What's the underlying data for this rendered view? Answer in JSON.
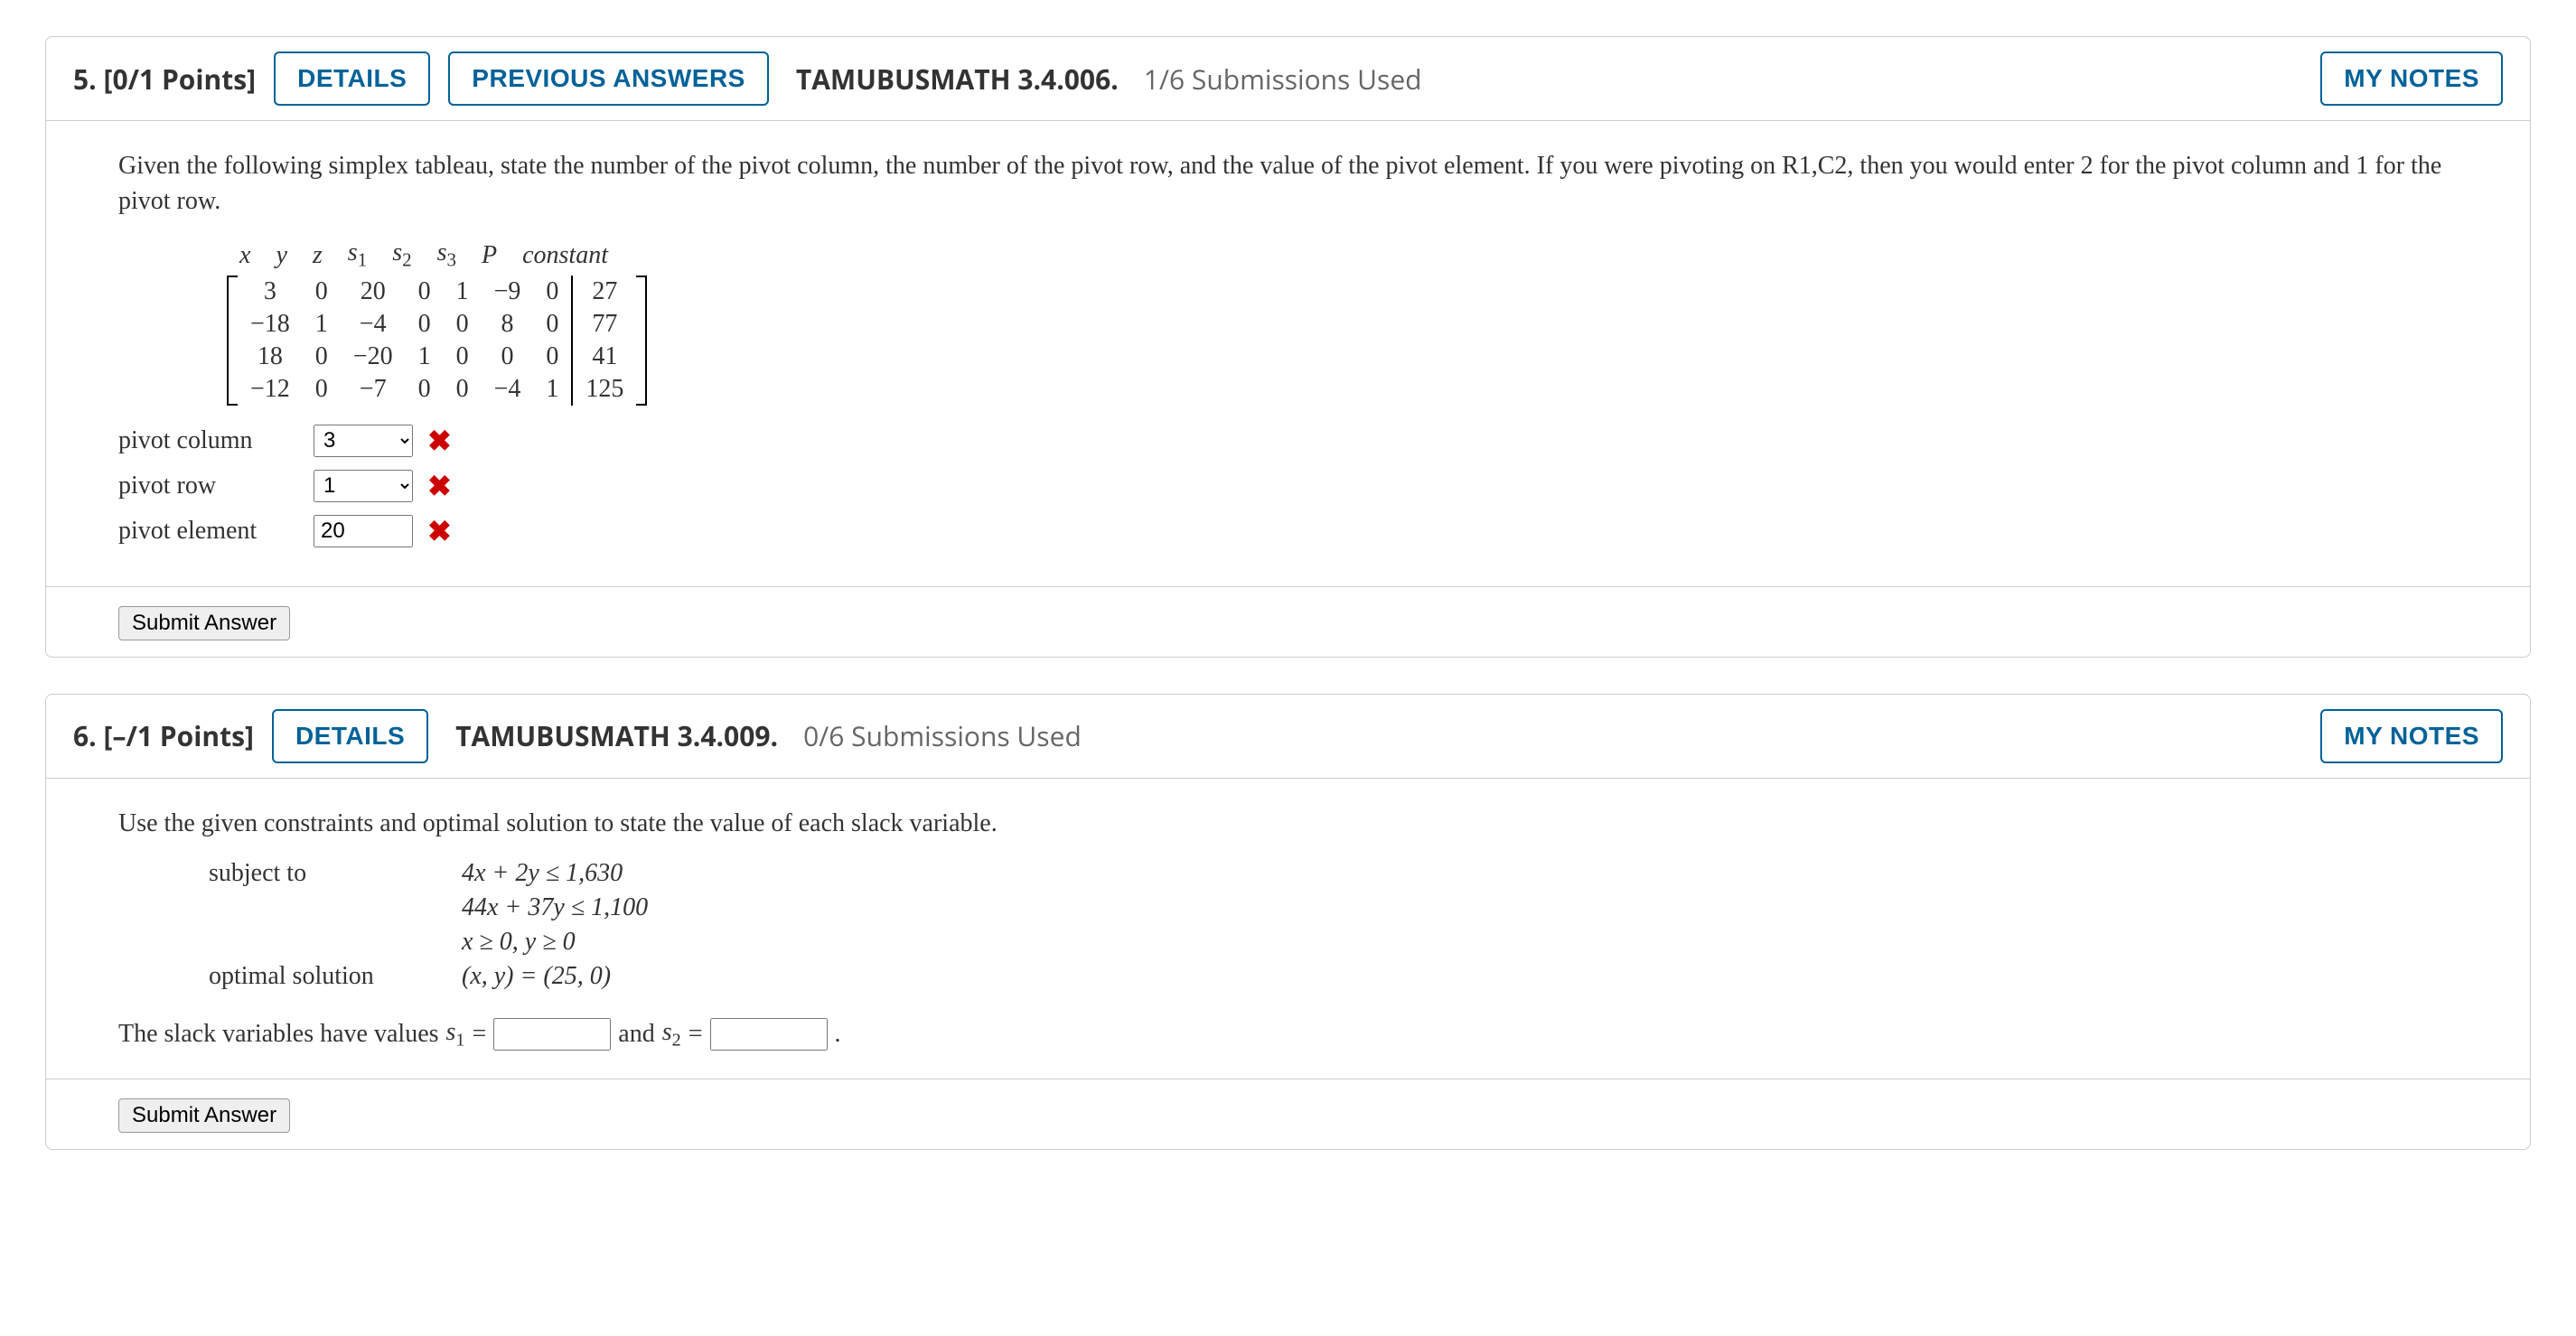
{
  "q5": {
    "number": "5.",
    "points": "[0/1 Points]",
    "details": "DETAILS",
    "prev": "PREVIOUS ANSWERS",
    "probId": "TAMUBUSMATH 3.4.006.",
    "subUsed": "1/6 Submissions Used",
    "myNotes": "MY NOTES",
    "instr": "Given the following simplex tableau, state the number of the pivot column, the number of the pivot row, and the value of the pivot element. If you were pivoting on R1,C2, then you would enter 2 for the pivot column and 1 for the pivot row.",
    "headers": {
      "x": "x",
      "y": "y",
      "z": "z",
      "s1a": "s",
      "s1b": "1",
      "s2a": "s",
      "s2b": "2",
      "s3a": "s",
      "s3b": "3",
      "P": "P",
      "const": "constant"
    },
    "rows": [
      [
        "3",
        "0",
        "20",
        "0",
        "1",
        "−9",
        "0",
        "27"
      ],
      [
        "−18",
        "1",
        "−4",
        "0",
        "0",
        "8",
        "0",
        "77"
      ],
      [
        "18",
        "0",
        "−20",
        "1",
        "0",
        "0",
        "0",
        "41"
      ],
      [
        "−12",
        "0",
        "−7",
        "0",
        "0",
        "−4",
        "1",
        "125"
      ]
    ],
    "answers": {
      "pcLabel": "pivot column",
      "pcVal": "3",
      "prLabel": "pivot row",
      "prVal": "1",
      "peLabel": "pivot element",
      "peVal": "20"
    },
    "submit": "Submit Answer"
  },
  "q6": {
    "number": "6.",
    "points": "[–/1 Points]",
    "details": "DETAILS",
    "probId": "TAMUBUSMATH 3.4.009.",
    "subUsed": "0/6 Submissions Used",
    "myNotes": "MY NOTES",
    "instr": "Use the given constraints and optimal solution to state the value of each slack variable.",
    "subjectTo": "subject to",
    "c1": "4x + 2y ≤ 1,630",
    "c2": "44x + 37y ≤ 1,100",
    "c3": "x ≥ 0, y ≥ 0",
    "optLabel": "optimal solution",
    "opt": "(x, y) = (25, 0)",
    "slackPre": "The slack variables have values ",
    "s1a": "s",
    "s1b": "1",
    "eq": " = ",
    "and": " and ",
    "s2a": "s",
    "s2b": "2",
    "period": " .",
    "submit": "Submit Answer"
  }
}
